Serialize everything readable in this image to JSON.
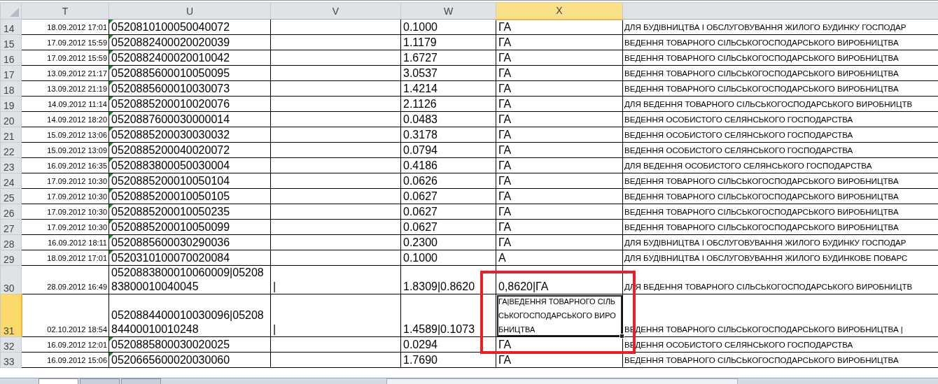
{
  "columns": [
    {
      "label": "T",
      "selected": false
    },
    {
      "label": "U",
      "selected": false
    },
    {
      "label": "V",
      "selected": false
    },
    {
      "label": "W",
      "selected": false
    },
    {
      "label": "X",
      "selected": true
    }
  ],
  "sheet_tabs": [
    {
      "selected": true
    },
    {
      "selected": false
    },
    {
      "selected": false
    }
  ],
  "rows": [
    {
      "number": "14",
      "selected": false,
      "flag": true,
      "t": "18.09.2012 17:01",
      "u": "0520810100050040072",
      "v": "",
      "w": "0.1000",
      "x": "ГА",
      "y": "ДЛЯ БУДІВНИЦТВА І ОБСЛУГОВУВАННЯ ЖИЛОГО БУДИНКУ ГОСПОДАР"
    },
    {
      "number": "15",
      "selected": false,
      "flag": true,
      "t": "17.09.2012 15:59",
      "u": "0520882400020020039",
      "v": "",
      "w": "1.1179",
      "x": "ГА",
      "y": "ВЕДЕННЯ ТОВАРНОГО СІЛЬСЬКОГОСПОДАРСЬКОГО ВИРОБНИЦТВА"
    },
    {
      "number": "16",
      "selected": false,
      "flag": true,
      "t": "17.09.2012 15:59",
      "u": "0520882400020010042",
      "v": "",
      "w": "1.6727",
      "x": "ГА",
      "y": "ВЕДЕННЯ ТОВАРНОГО СІЛЬСЬКОГОСПОДАРСЬКОГО ВИРОБНИЦТВА"
    },
    {
      "number": "17",
      "selected": false,
      "flag": true,
      "t": "13.09.2012 21:17",
      "u": "0520885600010050095",
      "v": "",
      "w": "3.0537",
      "x": "ГА",
      "y": "ВЕДЕННЯ ТОВАРНОГО СІЛЬСЬКОГОСПОДАРСЬКОГО ВИРОБНИЦТВА"
    },
    {
      "number": "18",
      "selected": false,
      "flag": true,
      "t": "13.09.2012 21:19",
      "u": "0520885600010030073",
      "v": "",
      "w": "1.4214",
      "x": "ГА",
      "y": "ВЕДЕННЯ ТОВАРНОГО СІЛЬСЬКОГОСПОДАРСЬКОГО ВИРОБНИЦТВА"
    },
    {
      "number": "19",
      "selected": false,
      "flag": true,
      "t": "14.09.2012 11:14",
      "u": "0520885200010020076",
      "v": "",
      "w": "2.1126",
      "x": "ГА",
      "y": "ДЛЯ ВЕДЕННЯ ТОВАРНОГО СІЛЬСЬКОГОСПОДАРСЬКОГО ВИРОБНИЦТВ"
    },
    {
      "number": "20",
      "selected": false,
      "flag": true,
      "t": "14.09.2012 18:20",
      "u": "0520887600030000014",
      "v": "",
      "w": "0.0483",
      "x": "ГА",
      "y": "ВЕДЕННЯ ОСОБИСТОГО СЕЛЯНСЬКОГО ГОСПОДАРСТВА"
    },
    {
      "number": "21",
      "selected": false,
      "flag": true,
      "t": "15.09.2012 13:06",
      "u": "0520885200030030032",
      "v": "",
      "w": "0.3178",
      "x": "ГА",
      "y": "ВЕДЕННЯ ОСОБИСТОГО СЕЛЯНСЬКОГО ГОСПОДАРСТВА"
    },
    {
      "number": "22",
      "selected": false,
      "flag": true,
      "t": "15.09.2012 13:09",
      "u": "0520885200040020072",
      "v": "",
      "w": "0.0794",
      "x": "ГА",
      "y": "ВЕДЕННЯ ОСОБИСТОГО СЕЛЯНСЬКОГО ГОСПОДАРСТВА"
    },
    {
      "number": "23",
      "selected": false,
      "flag": true,
      "t": "16.09.2012 16:35",
      "u": "0520883800050030004",
      "v": "",
      "w": "0.4186",
      "x": "ГА",
      "y": "ДЛЯ ВЕДЕННЯ ОСОБИСТОГО СЕЛЯНСЬКОГО ГОСПОДАРСТВА"
    },
    {
      "number": "24",
      "selected": false,
      "flag": true,
      "t": "17.09.2012 10:30",
      "u": "0520885200010050104",
      "v": "",
      "w": "0.0626",
      "x": "ГА",
      "y": "ВЕДЕННЯ ТОВАРНОГО СІЛЬСЬКОГОСПОДАРСЬКОГО ВИРОБНИЦТВА"
    },
    {
      "number": "25",
      "selected": false,
      "flag": true,
      "t": "17.09.2012 10:30",
      "u": "0520885200010050105",
      "v": "",
      "w": "0.0627",
      "x": "ГА",
      "y": "ВЕДЕННЯ ТОВАРНОГО СІЛЬСЬКОГОСПОДАРСЬКОГО ВИРОБНИЦТВА"
    },
    {
      "number": "26",
      "selected": false,
      "flag": true,
      "t": "17.09.2012 10:30",
      "u": "0520885200010050235",
      "v": "",
      "w": "0.0627",
      "x": "ГА",
      "y": "ВЕДЕННЯ ТОВАРНОГО СІЛЬСЬКОГОСПОДАРСЬКОГО ВИРОБНИЦТВА"
    },
    {
      "number": "27",
      "selected": false,
      "flag": true,
      "t": "17.09.2012 10:30",
      "u": "0520885200010050099",
      "v": "",
      "w": "0.0627",
      "x": "ГА",
      "y": "ВЕДЕННЯ ТОВАРНОГО СІЛЬСЬКОГОСПОДАРСЬКОГО ВИРОБНИЦТВА"
    },
    {
      "number": "28",
      "selected": false,
      "flag": true,
      "t": "16.09.2012 18:11",
      "u": "0520885600030290036",
      "v": "",
      "w": "0.2300",
      "x": "ГА",
      "y": "ДЛЯ БУДІВНИЦТВА І ОБСЛУГОВУВАННЯ ЖИЛОГО БУДИНКУ ГОСПОДАР"
    },
    {
      "number": "29",
      "selected": false,
      "flag": true,
      "t": "18.09.2012 17:01",
      "u": "0520310100070020084",
      "v": "",
      "w": "0.1000",
      "x": "А",
      "y": "ДЛЯ БУДІВНИЦТВА І ОБСЛУГОВУВАННЯ ЖИЛОГО БУДИНКОВЕ ПОВАРС"
    },
    {
      "number": "30",
      "selected": false,
      "flag": false,
      "t": "28.09.2012 16:49",
      "u": "0520883800010060009|0520883800010040045",
      "v": "|",
      "w": "1.8309|0.8620",
      "x": "0,8620|ГА",
      "y": "ДЛЯ ВЕДЕННЯ ТОВАРНОГО СІЛЬСЬКОГОСПОДАРСЬКОГО ВИРОБНИЦТВ"
    },
    {
      "number": "31",
      "selected": true,
      "flag": false,
      "t": "02.10.2012 18:54",
      "u": "0520884400010030096|0520884400010010248",
      "v": "|",
      "w": "1.4589|0.1073",
      "x": "ГА|ВЕДЕННЯ ТОВАРНОГО СІЛЬСЬКОГОСПОДАРСЬКОГО ВИРОБНИЦТВА",
      "y": "ВЕДЕННЯ ТОВАРНОГО СІЛЬСЬКОГОСПОДАРСЬКОГО ВИРОБНИЦТВА |"
    },
    {
      "number": "32",
      "selected": false,
      "flag": true,
      "t": "16.09.2012 12:01",
      "u": "0520885800030020025",
      "v": "",
      "w": "0.0294",
      "x": "ГА",
      "y": "ВЕДЕННЯ ОСОБИСТОГО СЕЛЯНСЬКОГО ГОСПОДАРСТВА"
    },
    {
      "number": "33",
      "selected": false,
      "flag": true,
      "t": "16.09.2012 15:06",
      "u": "0520665600020030060",
      "v": "",
      "w": "1.7690",
      "x": "ГА",
      "y": "ВЕДЕННЯ ТОВАРНОГО СІЛЬСЬКОГОСПОДАРСЬКОГО ВИРОБНИЦТВА"
    }
  ]
}
